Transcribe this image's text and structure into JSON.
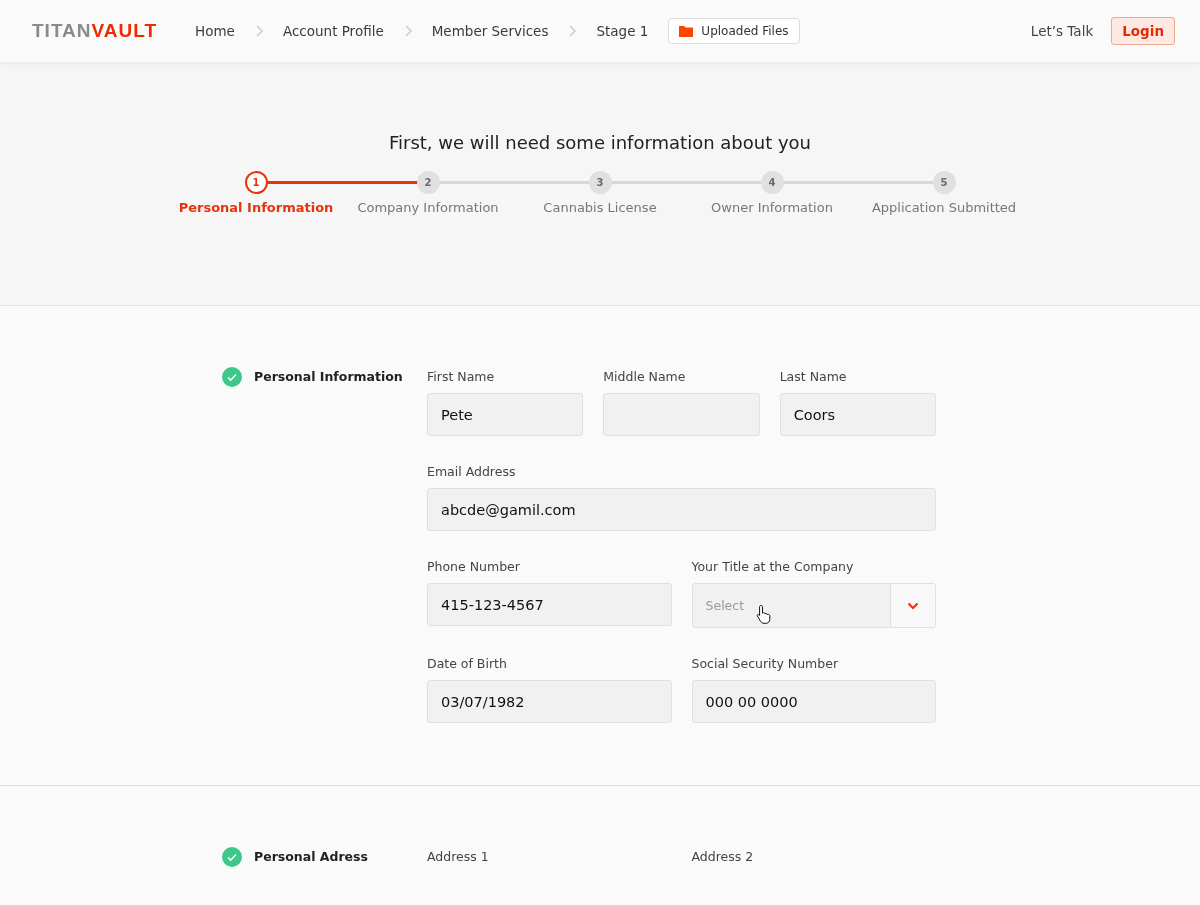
{
  "header": {
    "logo": {
      "part1": "TITAN",
      "part2": "VAULT"
    },
    "breadcrumbs": [
      {
        "label": "Home"
      },
      {
        "label": "Account Profile"
      },
      {
        "label": "Member Services"
      },
      {
        "label": "Stage 1"
      }
    ],
    "files_button": "Uploaded Files",
    "talk_link": "Let’s Talk",
    "login_button": "Login"
  },
  "hero": {
    "title": "First, we will need some information about you",
    "steps": [
      {
        "number": "1",
        "label": "Personal Information",
        "selected": true
      },
      {
        "number": "2",
        "label": "Company Information",
        "selected": false
      },
      {
        "number": "3",
        "label": "Cannabis License",
        "selected": false
      },
      {
        "number": "4",
        "label": "Owner Information",
        "selected": false
      },
      {
        "number": "5",
        "label": "Application Submitted",
        "selected": false
      }
    ]
  },
  "sections": [
    {
      "title": "Personal Information",
      "done": true,
      "rows": [
        [
          {
            "kind": "text",
            "label": "First Name",
            "value": "Pete"
          },
          {
            "kind": "text",
            "label": "Middle Name"
          },
          {
            "kind": "text",
            "label": "Last Name",
            "value": "Coors"
          }
        ],
        [
          {
            "kind": "text",
            "label": "Email Address",
            "value": "abcde@gamil.com"
          }
        ],
        [
          {
            "kind": "text",
            "label": "Phone Number",
            "value": "415-123-4567"
          },
          {
            "kind": "select",
            "label": "Your Title at the Company",
            "placeholder": "Select"
          }
        ],
        [
          {
            "kind": "text",
            "label": "Date of Birth",
            "value": "03/07/1982"
          },
          {
            "kind": "text",
            "label": "Social Security Number",
            "value": "000 00 0000"
          }
        ]
      ]
    },
    {
      "title": "Personal Adress",
      "done": true,
      "rows": [
        [
          {
            "kind": "cut",
            "label": "Address 1"
          },
          {
            "kind": "cut",
            "label": "Address 2"
          }
        ]
      ]
    }
  ]
}
